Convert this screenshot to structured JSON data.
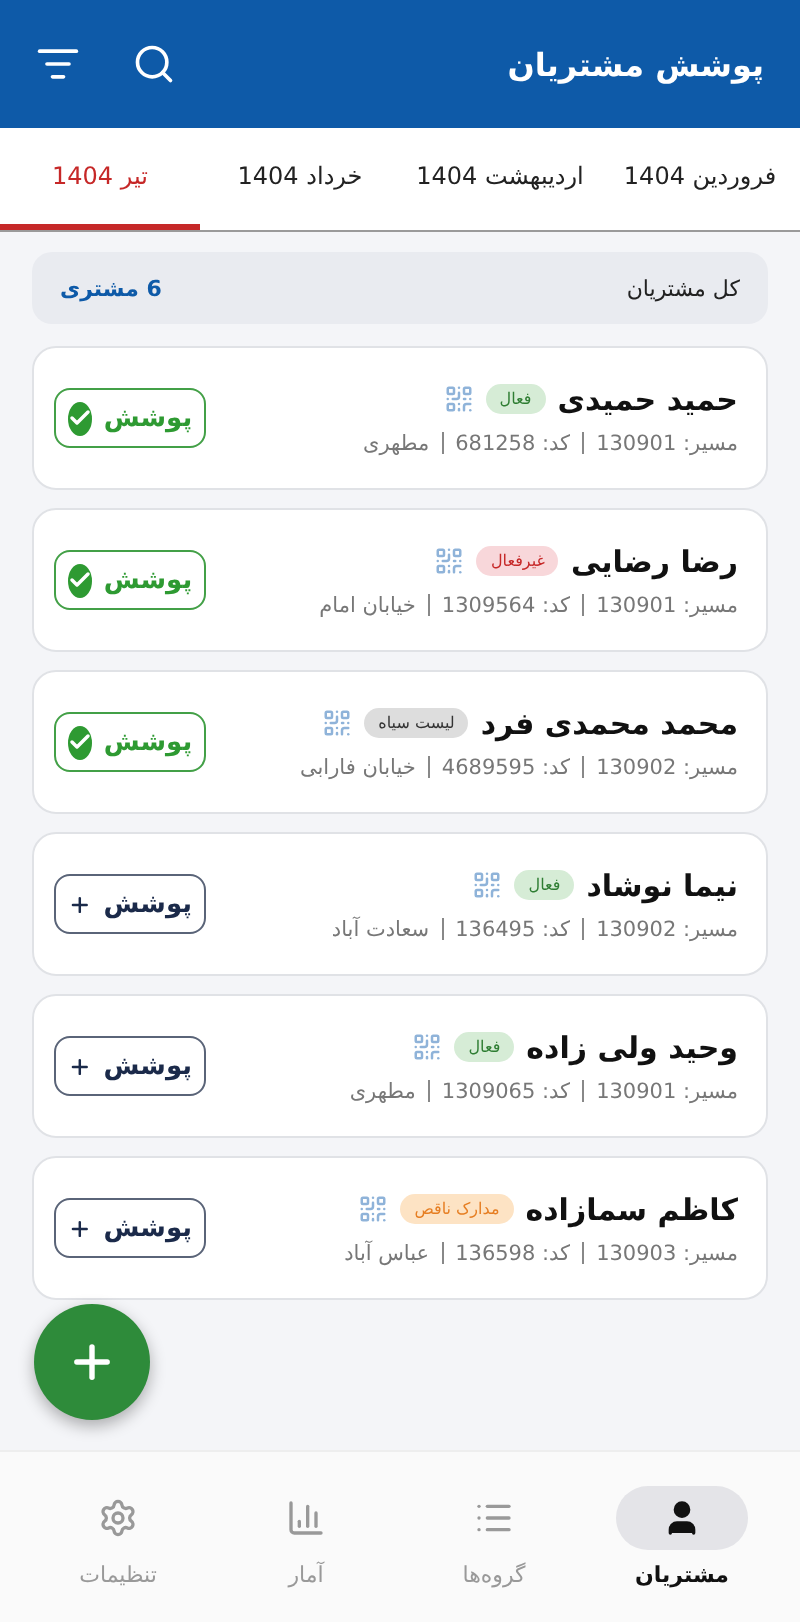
{
  "header": {
    "title": "پوشش مشتریان"
  },
  "tabs": [
    {
      "label": "فروردین 1404",
      "selected": false
    },
    {
      "label": "اردیبهشت 1404",
      "selected": false
    },
    {
      "label": "خرداد 1404",
      "selected": false
    },
    {
      "label": "تیر 1404",
      "selected": true
    }
  ],
  "summary": {
    "label": "کل مشتریان",
    "count": "6 مشتری"
  },
  "customers": [
    {
      "name": "حمید حمیدی",
      "tag": {
        "label": "فعال",
        "kind": "active"
      },
      "route": "مسیر: 130901",
      "code": "کد: 681258",
      "address": "مطهری",
      "button": "پوشش",
      "covered": true
    },
    {
      "name": "رضا رضایی",
      "tag": {
        "label": "غیرفعال",
        "kind": "inactive"
      },
      "route": "مسیر: 130901",
      "code": "کد: 1309564",
      "address": "خیابان امام",
      "button": "پوشش",
      "covered": true
    },
    {
      "name": "محمد محمدی فرد",
      "tag": {
        "label": "لیست سیاه",
        "kind": "blacklist"
      },
      "route": "مسیر: 130902",
      "code": "کد: 4689595",
      "address": "خیابان فارابی",
      "button": "پوشش",
      "covered": true
    },
    {
      "name": "نیما نوشاد",
      "tag": {
        "label": "فعال",
        "kind": "active"
      },
      "route": "مسیر: 130902",
      "code": "کد: 136495",
      "address": "سعادت آباد",
      "button": "پوشش",
      "covered": false
    },
    {
      "name": "وحید ولی زاده",
      "tag": {
        "label": "فعال",
        "kind": "active"
      },
      "route": "مسیر: 130901",
      "code": "کد: 1309065",
      "address": "مطهری",
      "button": "پوشش",
      "covered": false
    },
    {
      "name": "کاظم سمازاده",
      "tag": {
        "label": "مدارک ناقص",
        "kind": "docs"
      },
      "route": "مسیر: 130903",
      "code": "کد: 136598",
      "address": "عباس آباد",
      "button": "پوشش",
      "covered": false
    }
  ],
  "nav": [
    {
      "label": "مشتریان",
      "kind": "customers",
      "selected": true
    },
    {
      "label": "گروه‌ها",
      "kind": "groups",
      "selected": false
    },
    {
      "label": "آمار",
      "kind": "stats",
      "selected": false
    },
    {
      "label": "تنظیمات",
      "kind": "settings",
      "selected": false
    }
  ]
}
